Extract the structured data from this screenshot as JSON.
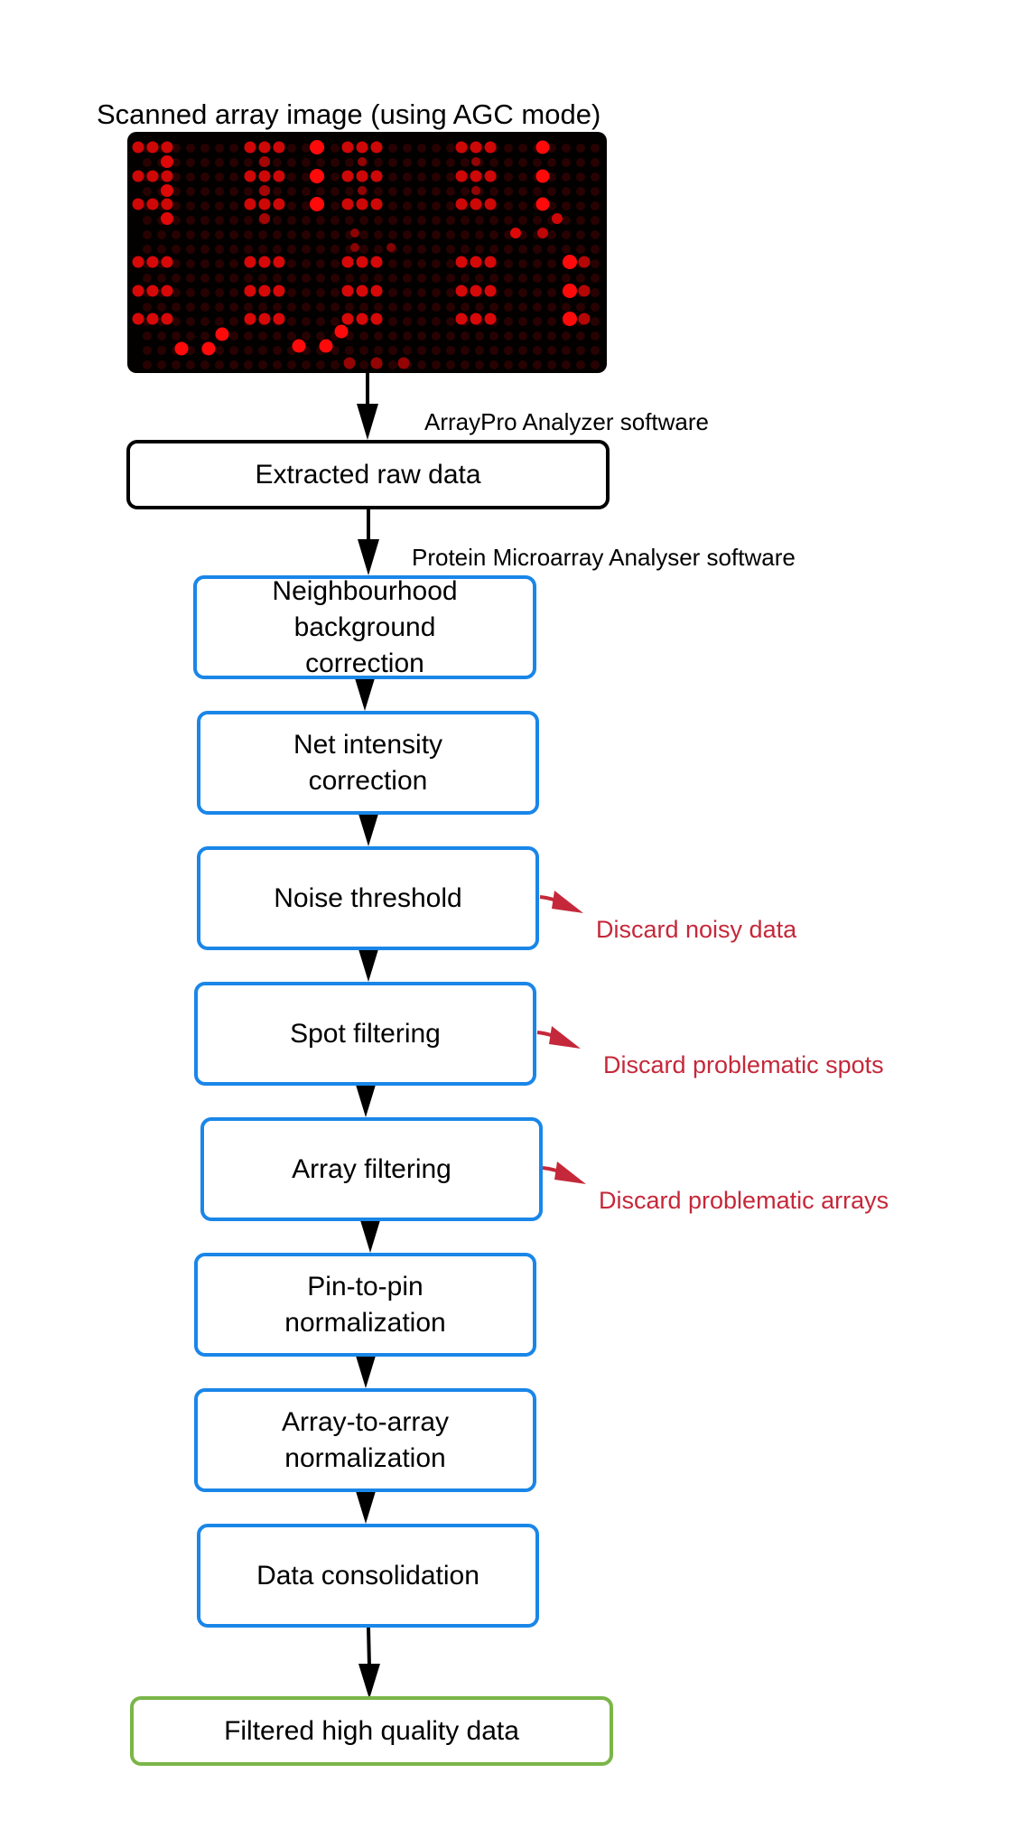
{
  "scanned_image": {
    "title": "Scanned array image (using AGC mode)"
  },
  "software_labels": {
    "arraypro": "ArrayPro Analyzer software",
    "pma": "Protein Microarray Analyser software"
  },
  "steps": {
    "raw": {
      "lines": [
        "Extracted raw data"
      ]
    },
    "neighbourhood": {
      "lines": [
        "Neighbourhood",
        "background",
        "correction"
      ]
    },
    "net_intensity": {
      "lines": [
        "Net intensity",
        "correction"
      ]
    },
    "noise": {
      "lines": [
        "Noise threshold"
      ]
    },
    "spot": {
      "lines": [
        "Spot filtering"
      ]
    },
    "array": {
      "lines": [
        "Array filtering"
      ]
    },
    "pin": {
      "lines": [
        "Pin-to-pin",
        "normalization"
      ]
    },
    "a2a": {
      "lines": [
        "Array-to-array",
        "normalization"
      ]
    },
    "consolidation": {
      "lines": [
        "Data consolidation"
      ]
    },
    "final": {
      "lines": [
        "Filtered high quality data"
      ]
    }
  },
  "discard_labels": {
    "noise": "Discard noisy data",
    "spot": "Discard problematic spots",
    "array": "Discard problematic arrays"
  },
  "colors": {
    "process_border": "#1a86e8",
    "raw_border": "#000000",
    "final_border": "#7ab648",
    "discard": "#c5283a",
    "arrow": "#000000",
    "spot_red": "#ff1a1a"
  }
}
